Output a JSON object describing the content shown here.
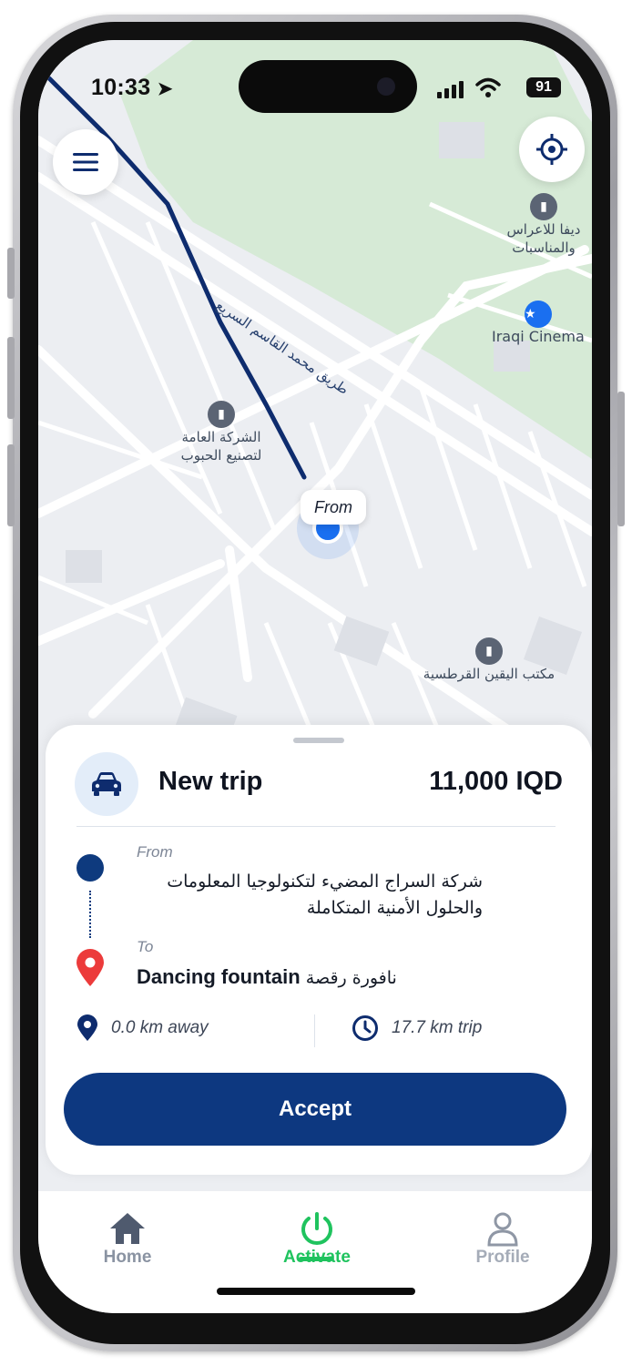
{
  "status_bar": {
    "time": "10:33",
    "battery": "91"
  },
  "map": {
    "road_label": "طريق محمد القاسم السريع",
    "pois": [
      {
        "name": "ديفا للاعراس والمناسبات"
      },
      {
        "name": "Iraqi Cinema"
      },
      {
        "name": "الشركة العامة لتصنيع الحبوب"
      },
      {
        "name": "مكتب اليقين القرطسية"
      }
    ],
    "pickup_tag": "From"
  },
  "trip_card": {
    "title": "New trip",
    "price": "11,000 IQD",
    "from_label": "From",
    "from_address": "شركة السراج المضيء لتكنولوجيا المعلومات والحلول الأمنية المتكاملة",
    "to_label": "To",
    "to_name": "Dancing fountain",
    "to_name_ar": "نافورة رقصة",
    "distance_away": "0.0 km away",
    "trip_distance": "17.7 km trip",
    "accept_label": "Accept"
  },
  "bottom_nav": {
    "items": [
      {
        "label": "Home",
        "icon": "home-icon"
      },
      {
        "label": "Activate",
        "icon": "power-icon",
        "active": true
      },
      {
        "label": "Profile",
        "icon": "person-icon"
      }
    ]
  },
  "colors": {
    "primary": "#0d3880",
    "active": "#1fc35e",
    "route": "#0e2c6e",
    "pickup": "#1a6ff0"
  }
}
